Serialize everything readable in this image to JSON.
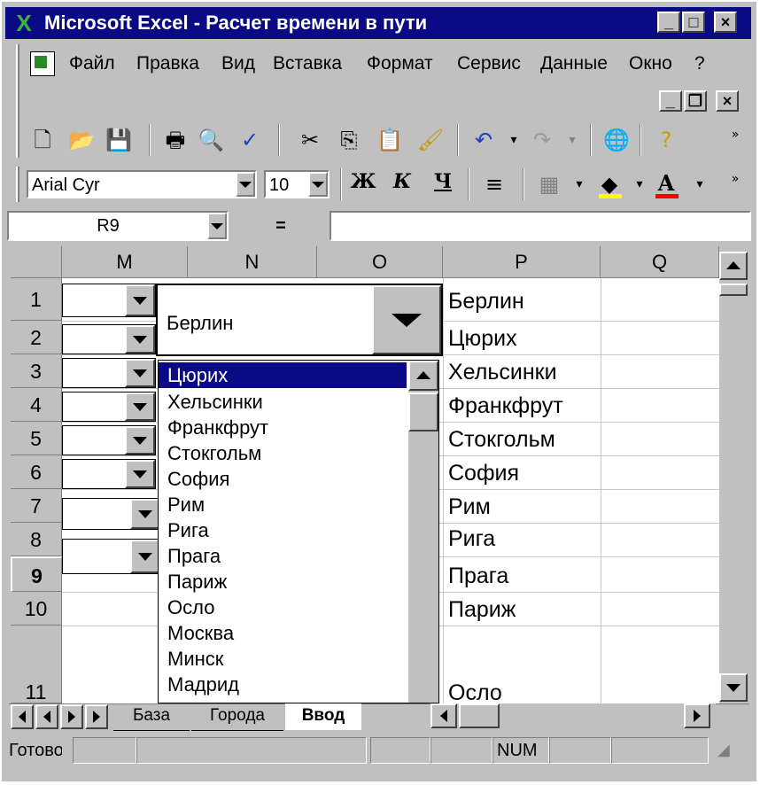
{
  "window": {
    "title": "Microsoft Excel - Расчет времени в пути",
    "minimize": "_",
    "maximize": "□",
    "close": "×",
    "doc_minimize": "_",
    "doc_restore": "❐",
    "doc_close": "×"
  },
  "menu": {
    "items": [
      "Файл",
      "Правка",
      "Вид",
      "Вставка",
      "Формат",
      "Сервис",
      "Данные",
      "Окно",
      "?"
    ]
  },
  "toolbar": {
    "font_name": "Arial Cyr",
    "font_size": "10",
    "bold": "Ж",
    "italic": "К",
    "underline": "Ч",
    "icons": [
      "new-icon",
      "open-icon",
      "save-icon",
      "print-icon",
      "print-preview-icon",
      "spelling-icon",
      "cut-icon",
      "copy-icon",
      "paste-icon",
      "format-painter-icon",
      "undo-icon",
      "redo-icon",
      "web-toolbar-icon",
      "office-assistant-icon",
      "align-icon",
      "borders-icon",
      "fill-color-icon",
      "font-color-icon"
    ],
    "fill_color": "#ffff00",
    "font_color": "#ff0000"
  },
  "formula_bar": {
    "name_box": "R9",
    "equals": "=",
    "formula": ""
  },
  "grid": {
    "columns": [
      "M",
      "N",
      "O",
      "P",
      "Q"
    ],
    "rows": [
      "1",
      "2",
      "3",
      "4",
      "5",
      "6",
      "7",
      "8",
      "9",
      "10",
      "11"
    ],
    "active_row": "9",
    "column_p": [
      "Берлин",
      "Цюрих",
      "Хельсинки",
      "Франкфрут",
      "Стокгольм",
      "София",
      "Рим",
      "Рига",
      "Прага",
      "Париж",
      "Осло"
    ]
  },
  "combo": {
    "value": "Берлин"
  },
  "dropdown_list": {
    "items": [
      "Цюрих",
      "Хельсинки",
      "Франкфрут",
      "Стокгольм",
      "София",
      "Рим",
      "Рига",
      "Прага",
      "Париж",
      "Осло",
      "Москва",
      "Минск",
      "Мадрид"
    ],
    "selected": "Цюрих",
    "highlight_color": "#0a0a84"
  },
  "sheets": {
    "tabs": [
      "База",
      "Города",
      "Ввод"
    ],
    "active": "Ввод"
  },
  "status_bar": {
    "ready": "Готово",
    "num": "NUM"
  }
}
